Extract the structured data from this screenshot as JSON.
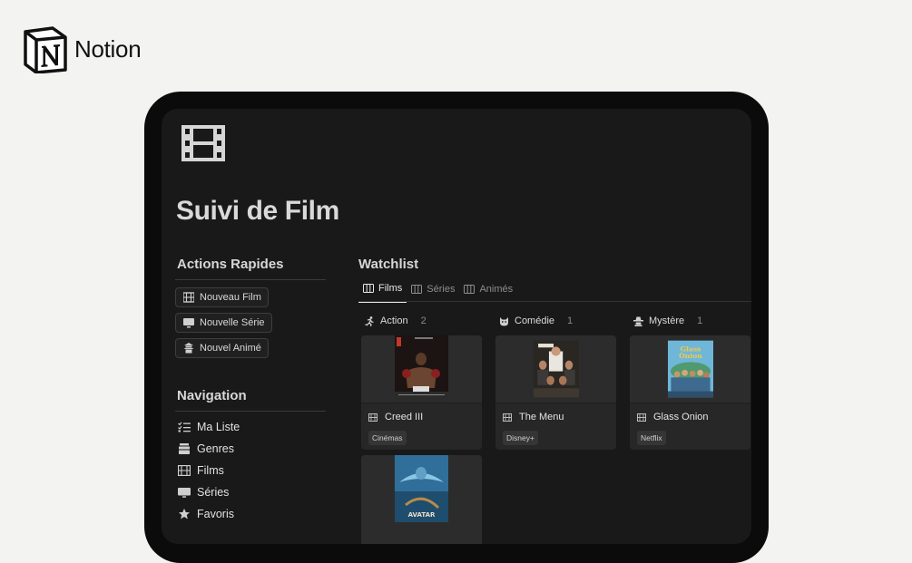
{
  "brand": {
    "name": "Notion"
  },
  "page": {
    "title": "Suivi de Film",
    "icon": "film-icon"
  },
  "quick_actions": {
    "heading": "Actions Rapides",
    "buttons": [
      {
        "label": "Nouveau Film",
        "icon": "film-icon"
      },
      {
        "label": "Nouvelle Série",
        "icon": "tv-icon"
      },
      {
        "label": "Nouvel Animé",
        "icon": "pagoda-icon"
      }
    ]
  },
  "navigation": {
    "heading": "Navigation",
    "items": [
      {
        "label": "Ma Liste",
        "icon": "checklist-icon"
      },
      {
        "label": "Genres",
        "icon": "stack-icon"
      },
      {
        "label": "Films",
        "icon": "film-icon"
      },
      {
        "label": "Séries",
        "icon": "tv-icon"
      },
      {
        "label": "Favoris",
        "icon": "star-icon"
      }
    ]
  },
  "watchlist": {
    "heading": "Watchlist",
    "tabs": [
      {
        "label": "Films",
        "active": true
      },
      {
        "label": "Séries",
        "active": false
      },
      {
        "label": "Animés",
        "active": false
      }
    ],
    "columns": [
      {
        "name": "Action",
        "count": "2",
        "icon": "running-icon",
        "cards": [
          {
            "title": "Creed III",
            "tag": "Cinémas"
          },
          {
            "title": "",
            "tag": ""
          }
        ]
      },
      {
        "name": "Comédie",
        "count": "1",
        "icon": "cat-icon",
        "cards": [
          {
            "title": "The Menu",
            "tag": "Disney+"
          }
        ]
      },
      {
        "name": "Mystère",
        "count": "1",
        "icon": "detective-icon",
        "cards": [
          {
            "title": "Glass Onion",
            "tag": "Netflix"
          }
        ]
      }
    ]
  },
  "colors": {
    "background": "#f3f3f2",
    "device": "#0b0b0b",
    "screen": "#191919",
    "card": "#272727"
  }
}
